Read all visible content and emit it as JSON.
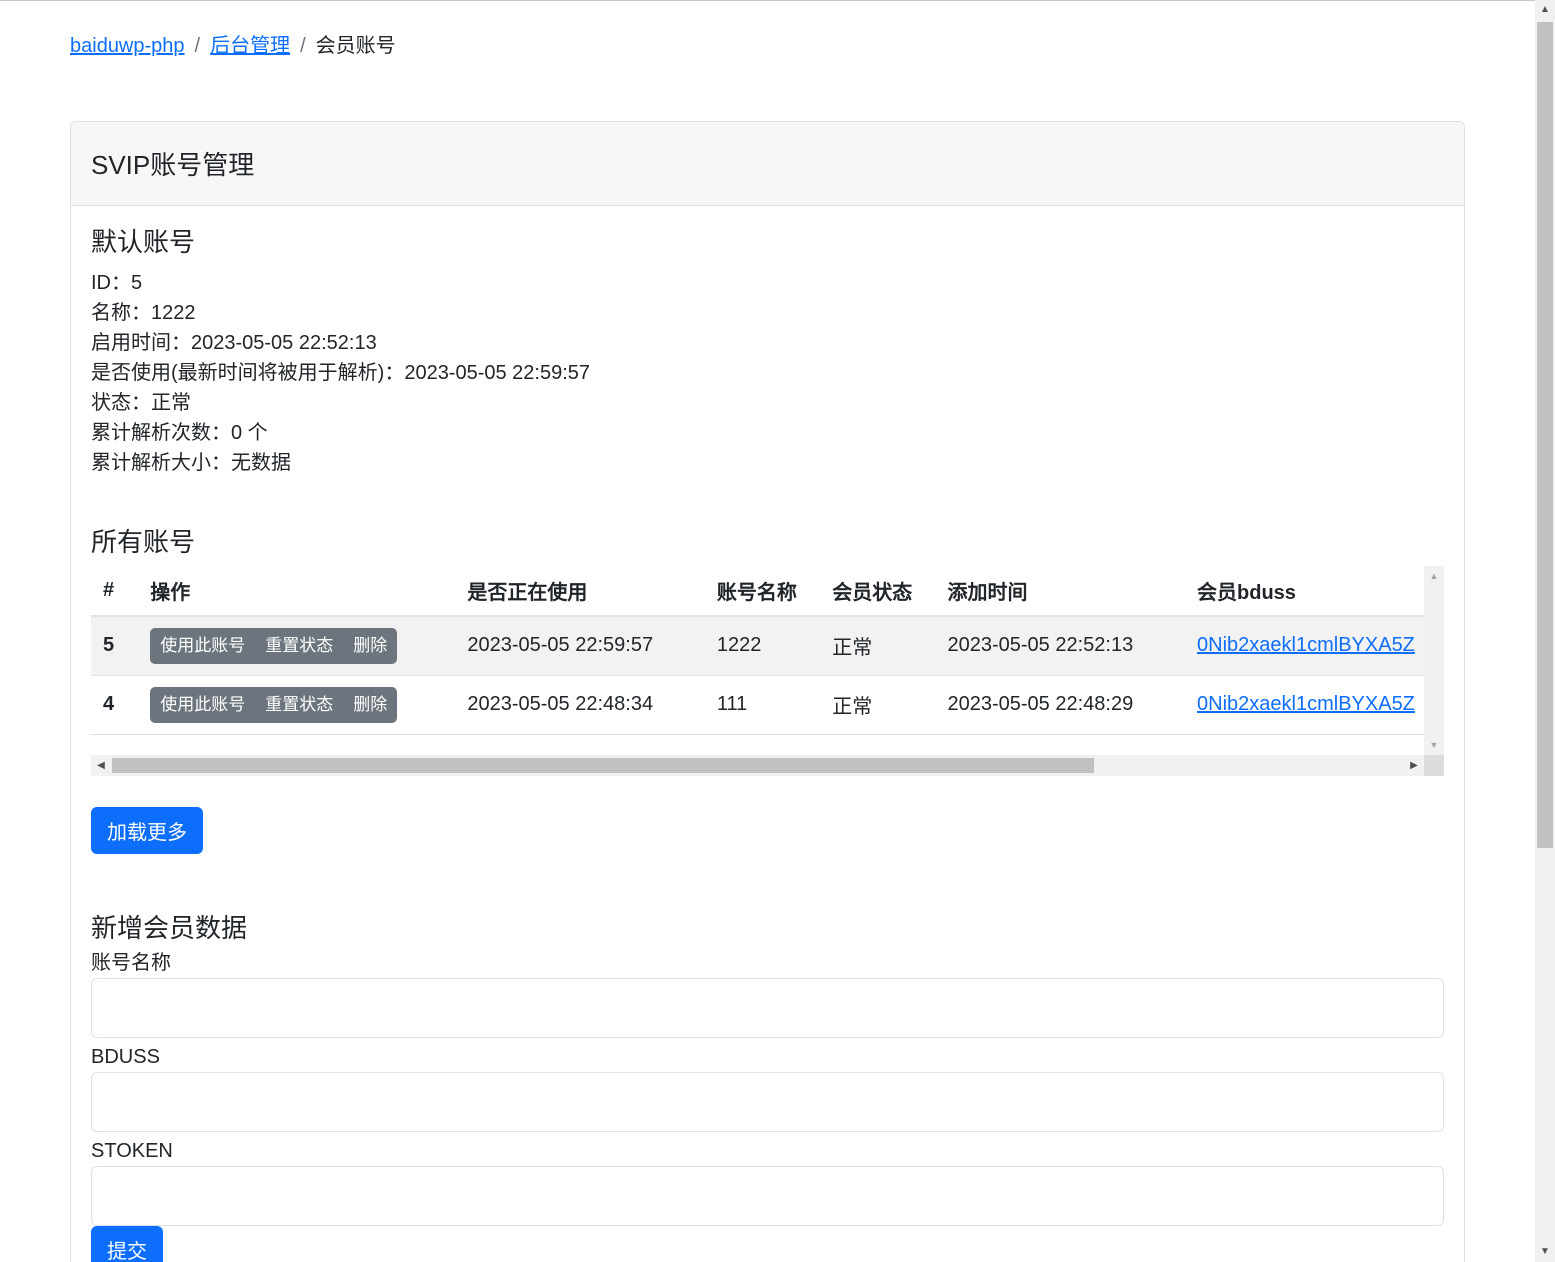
{
  "breadcrumb": {
    "home": "baiduwp-php",
    "sep": "/",
    "admin": "后台管理",
    "current": "会员账号"
  },
  "card": {
    "title": "SVIP账号管理"
  },
  "default_account": {
    "heading": "默认账号",
    "lines": [
      "ID：5",
      "名称：1222",
      "启用时间：2023-05-05 22:52:13",
      "是否使用(最新时间将被用于解析)：2023-05-05 22:59:57",
      "状态：正常",
      "累计解析次数：0 个",
      "累计解析大小：无数据"
    ]
  },
  "all_accounts": {
    "heading": "所有账号",
    "columns": [
      "#",
      "操作",
      "是否正在使用",
      "账号名称",
      "会员状态",
      "添加时间",
      "会员bduss"
    ],
    "actions": {
      "use": "使用此账号",
      "reset": "重置状态",
      "delete": "删除"
    },
    "rows": [
      {
        "id": "5",
        "in_use": "2023-05-05 22:59:57",
        "name": "1222",
        "status": "正常",
        "added": "2023-05-05 22:52:13",
        "bduss": "0Nib2xaekl1cmlBYXA5Z"
      },
      {
        "id": "4",
        "in_use": "2023-05-05 22:48:34",
        "name": "111",
        "status": "正常",
        "added": "2023-05-05 22:48:29",
        "bduss": "0Nib2xaekl1cmlBYXA5Z"
      }
    ],
    "load_more": "加载更多"
  },
  "new_account": {
    "heading": "新增会员数据",
    "name_label": "账号名称",
    "bduss_label": "BDUSS",
    "stoken_label": "STOKEN",
    "name_value": "",
    "bduss_value": "",
    "stoken_value": "",
    "submit": "提交"
  },
  "icons": {
    "scroll_up": "triangle-up-icon",
    "scroll_down": "triangle-down-icon",
    "scroll_left": "triangle-left-icon",
    "scroll_right": "triangle-right-icon"
  },
  "colors": {
    "primary": "#0d6efd",
    "secondary": "#6c757d",
    "link": "#0d6efd"
  }
}
